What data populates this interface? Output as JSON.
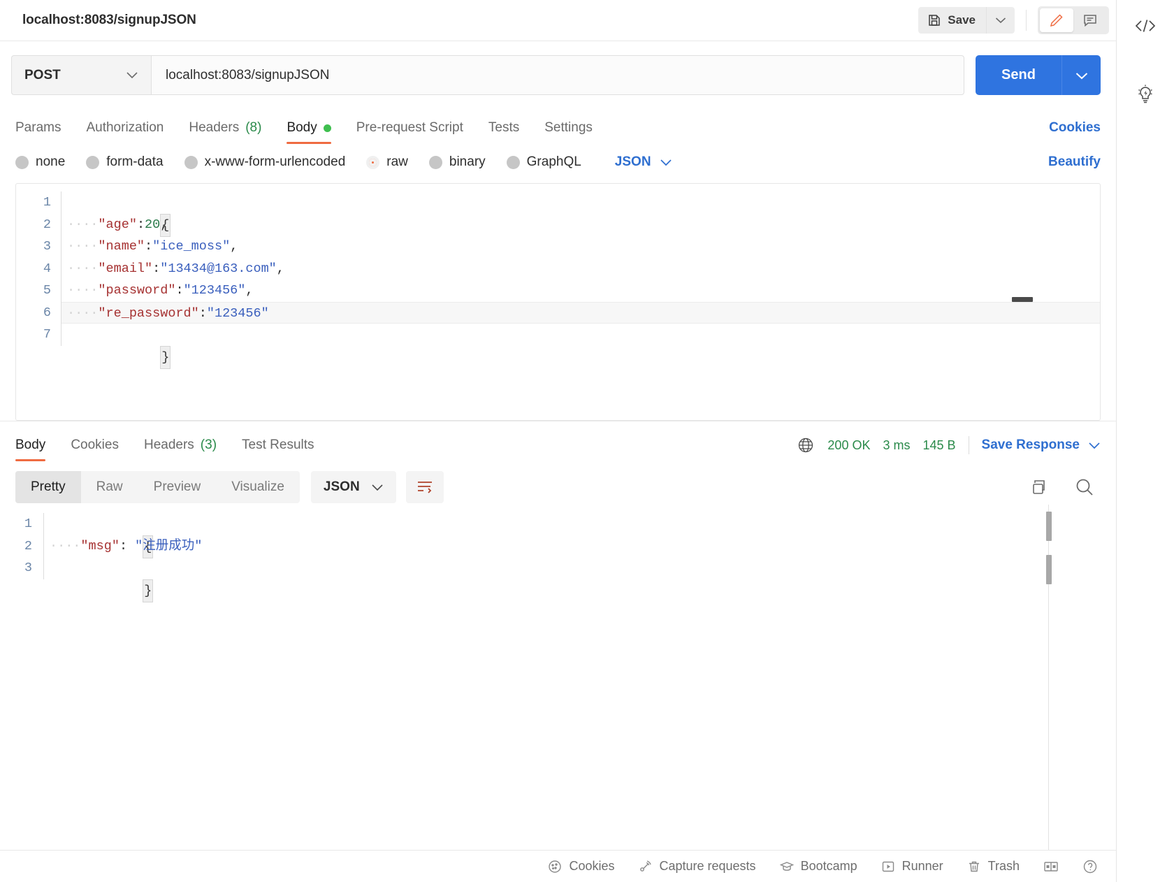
{
  "topbar": {
    "request_title": "localhost:8083/signupJSON",
    "save_label": "Save",
    "save_icon": "floppy-disk-icon",
    "save_caret_icon": "chevron-down-icon",
    "edit_icon": "pencil-icon",
    "comment_icon": "comment-icon"
  },
  "url_row": {
    "method": "POST",
    "method_caret_icon": "chevron-down-icon",
    "url": "localhost:8083/signupJSON",
    "send_label": "Send",
    "send_caret_icon": "chevron-down-icon"
  },
  "request_tabs": {
    "items": [
      {
        "label": "Params",
        "active": false
      },
      {
        "label": "Authorization",
        "active": false
      },
      {
        "label": "Headers",
        "count": "(8)",
        "active": false
      },
      {
        "label": "Body",
        "active": true,
        "dot": true
      },
      {
        "label": "Pre-request Script",
        "active": false
      },
      {
        "label": "Tests",
        "active": false
      },
      {
        "label": "Settings",
        "active": false
      }
    ],
    "cookies_link": "Cookies"
  },
  "body_type_row": {
    "options": [
      {
        "label": "none",
        "selected": false
      },
      {
        "label": "form-data",
        "selected": false
      },
      {
        "label": "x-www-form-urlencoded",
        "selected": false
      },
      {
        "label": "raw",
        "selected": true
      },
      {
        "label": "binary",
        "selected": false
      },
      {
        "label": "GraphQL",
        "selected": false
      }
    ],
    "format": "JSON",
    "format_caret_icon": "chevron-down-icon",
    "beautify_label": "Beautify"
  },
  "request_body": {
    "line_numbers": [
      "1",
      "2",
      "3",
      "4",
      "5",
      "6",
      "7"
    ],
    "lines": [
      {
        "n": "1",
        "text": "{"
      },
      {
        "n": "2",
        "key": "\"age\"",
        "colon": ":",
        "num": "20",
        "tail": ","
      },
      {
        "n": "3",
        "key": "\"name\"",
        "colon": ":",
        "str": "\"ice_moss\"",
        "tail": ","
      },
      {
        "n": "4",
        "key": "\"email\"",
        "colon": ":",
        "str": "\"13434@163.com\"",
        "tail": ","
      },
      {
        "n": "5",
        "key": "\"password\"",
        "colon": ":",
        "str": "\"123456\"",
        "tail": ","
      },
      {
        "n": "6",
        "key": "\"re_password\"",
        "colon": ":",
        "str": "\"123456\"",
        "tail": "",
        "highlight": true
      },
      {
        "n": "7",
        "text": "}"
      }
    ]
  },
  "response_tabs": {
    "items": [
      {
        "label": "Body",
        "active": true
      },
      {
        "label": "Cookies",
        "active": false
      },
      {
        "label": "Headers",
        "count": "(3)",
        "active": false
      },
      {
        "label": "Test Results",
        "active": false
      }
    ],
    "globe_icon": "globe-icon",
    "status": "200 OK",
    "time": "3 ms",
    "size": "145 B",
    "save_response_label": "Save Response",
    "save_response_caret_icon": "chevron-down-icon"
  },
  "response_toolbar": {
    "views": [
      {
        "label": "Pretty",
        "active": true
      },
      {
        "label": "Raw",
        "active": false
      },
      {
        "label": "Preview",
        "active": false
      },
      {
        "label": "Visualize",
        "active": false
      }
    ],
    "format": "JSON",
    "format_caret_icon": "chevron-down-icon",
    "wrap_icon": "word-wrap-icon",
    "copy_icon": "copy-icon",
    "search_icon": "search-icon"
  },
  "response_body": {
    "lines": [
      {
        "n": "1",
        "text": "{"
      },
      {
        "n": "2",
        "key": "\"msg\"",
        "colon": ": ",
        "str": "\"注册成功\""
      },
      {
        "n": "3",
        "text": "}"
      }
    ]
  },
  "footer": {
    "items": [
      {
        "label": "Cookies",
        "icon": "cookie-icon"
      },
      {
        "label": "Capture requests",
        "icon": "satellite-icon"
      },
      {
        "label": "Bootcamp",
        "icon": "graduation-cap-icon"
      },
      {
        "label": "Runner",
        "icon": "play-box-icon"
      },
      {
        "label": "Trash",
        "icon": "trash-icon"
      }
    ],
    "layout_icon": "two-pane-layout-icon",
    "help_icon": "help-circle-icon"
  },
  "right_rail": {
    "items": [
      {
        "icon": "code-brackets-icon"
      },
      {
        "icon": "lightbulb-bolt-icon"
      }
    ]
  },
  "colors": {
    "accent_orange": "#ef6b41",
    "primary_blue": "#2f74e0",
    "link_blue": "#2f6fd0",
    "success_green": "#2a8a4a",
    "dot_green": "#3fbf4f",
    "json_key": "#a63232",
    "json_string": "#3a5fbd",
    "json_number": "#2a7a4a"
  }
}
